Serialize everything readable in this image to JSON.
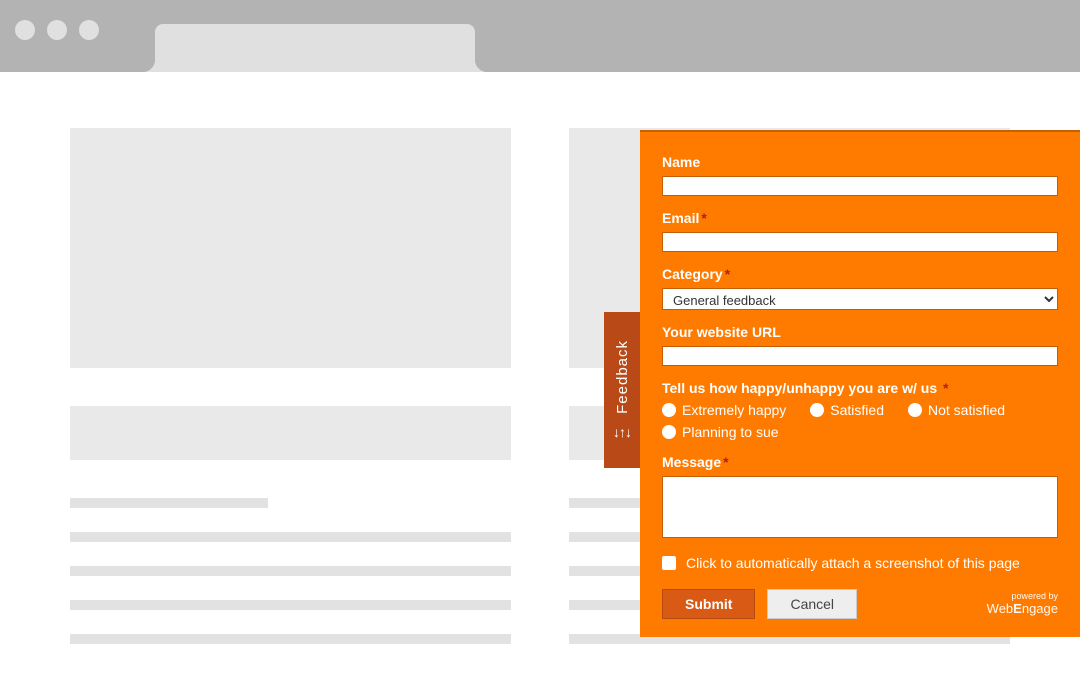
{
  "feedback_tab": {
    "label": "Feedback",
    "arrows": "↓↑↓"
  },
  "form": {
    "name": {
      "label": "Name",
      "value": ""
    },
    "email": {
      "label": "Email",
      "required": "*",
      "value": ""
    },
    "category": {
      "label": "Category",
      "required": "*",
      "selected": "General feedback"
    },
    "url": {
      "label": "Your website URL",
      "value": ""
    },
    "happiness": {
      "label": "Tell us how happy/unhappy you are w/ us",
      "required": "*",
      "options": [
        "Extremely happy",
        "Satisfied",
        "Not satisfied",
        "Planning to sue"
      ]
    },
    "message": {
      "label": "Message",
      "required": "*",
      "value": ""
    },
    "screenshot": {
      "label": "Click to automatically attach a screenshot of this page"
    },
    "submit": "Submit",
    "cancel": "Cancel",
    "powered_prefix": "powered by",
    "powered_brand_pre": "Web",
    "powered_brand_e": "E",
    "powered_brand_post": "ngage"
  }
}
